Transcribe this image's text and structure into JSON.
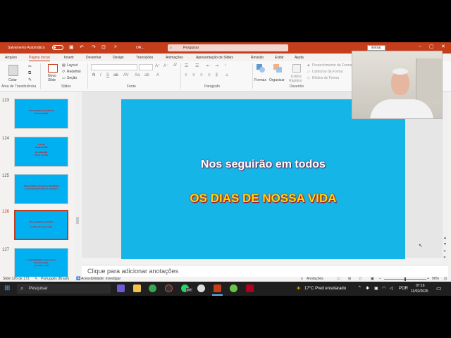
{
  "titlebar": {
    "autosave": "Salvamento Automático",
    "filename": "OR...",
    "search_placeholder": "Pesquisar",
    "signin": "Entrar"
  },
  "tabs": [
    "Arquivo",
    "Página Inicial",
    "Inserir",
    "Desenhar",
    "Design",
    "Transições",
    "Animações",
    "Apresentação de Slides",
    "Revisão",
    "Exibir",
    "Ajuda"
  ],
  "active_tab_index": 1,
  "ribbon": {
    "clipboard": {
      "paste": "Colar",
      "group": "Área de Transferência"
    },
    "slides": {
      "new_slide_1": "Novo",
      "new_slide_2": "Slide",
      "layout": "Layout",
      "reset": "Redefinir",
      "section": "Seção",
      "group": "Slides"
    },
    "font": {
      "group": "Fonte"
    },
    "paragraph": {
      "group": "Parágrafo"
    },
    "drawing": {
      "shapes": "Formas",
      "arrange": "Organizar",
      "styles_1": "Estilos",
      "styles_2": "Rápidos",
      "fill": "Preenchimento da Forma",
      "outline": "Contorno da Forma",
      "effects": "Efeitos de Forma",
      "group": "Desenho"
    }
  },
  "thumbnails": [
    {
      "number": "123",
      "lines": [
        "Tua bondade e fidelidade",
        "vão me seguir"
      ]
    },
    {
      "number": "124",
      "lines": [
        "e a tua",
        "misericórdia",
        "me seguirão",
        "todos os dias"
      ]
    },
    {
      "number": "125",
      "lines": [
        "Tua bondade, teu amor e fidelidade",
        "e a tua misericórdia me seguirão"
      ]
    },
    {
      "number": "126",
      "lines": [
        "Nos seguirão em todos",
        "os dias de nossa vida"
      ]
    },
    {
      "number": "127",
      "lines": [
        "A tua fidelidade e o teu amor",
        "vão me seguir",
        "por toda a vida"
      ]
    }
  ],
  "selected_thumbnail_index": 3,
  "slide": {
    "line1": "Nos seguirão em todos",
    "line2": "OS DIAS DE NOSSA VIDA",
    "bg_color": "#15b5e8"
  },
  "notes_placeholder": "Clique para adicionar anotações",
  "status": {
    "slide_counter": "Slide 126 de 173",
    "language": "Português (Brasil)",
    "accessibility": "Acessibilidade: investigar",
    "notes": "Anotações",
    "zoom": "90%"
  },
  "taskbar": {
    "search": "Pesquisar",
    "weather": "17°C  Pred ensolarado",
    "lang": "POR",
    "time": "07:16",
    "date": "11/02/2025",
    "badge": "99+"
  },
  "colors": {
    "accent": "#c43e1c",
    "slide_text_1": "#ffffff",
    "slide_text_2": "#ffd800",
    "thumb_text": "#ff0000"
  }
}
